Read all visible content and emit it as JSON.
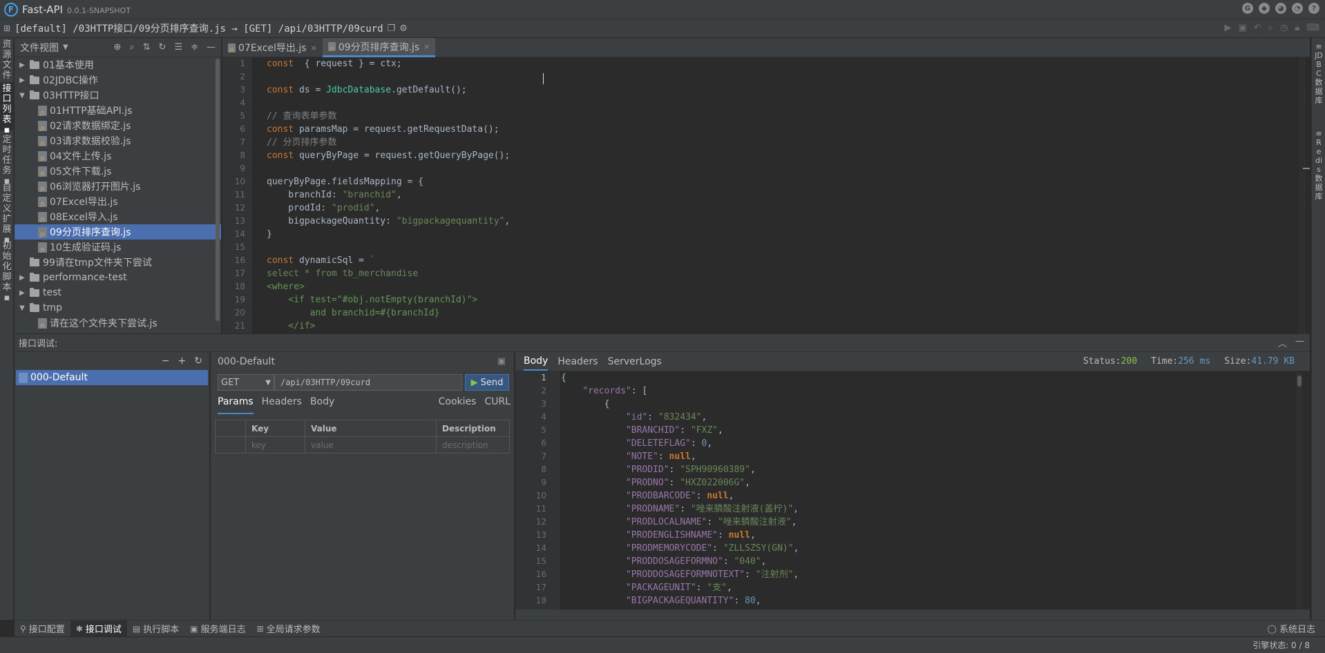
{
  "app": {
    "name": "Fast-API",
    "version": "0.0.1-SNAPSHOT",
    "logo_letter": "F"
  },
  "pathbar": {
    "path": "[default] /03HTTP接口/09分页排序查询.js → [GET] /api/03HTTP/09curd"
  },
  "left_tabs": [
    "资源文件",
    "接口列表",
    "定时任务",
    "自定义扩展",
    "初始化脚本"
  ],
  "right_tabs": [
    "JDBC数据库",
    "Redis数据库"
  ],
  "tree": {
    "title": "文件视图",
    "items": [
      {
        "label": "01基本使用",
        "type": "folder",
        "level": 0,
        "arrow": "▶"
      },
      {
        "label": "02JDBC操作",
        "type": "folder",
        "level": 0,
        "arrow": "▶"
      },
      {
        "label": "03HTTP接口",
        "type": "folder",
        "level": 0,
        "arrow": "▼"
      },
      {
        "label": "01HTTP基础API.js",
        "type": "file",
        "level": 1
      },
      {
        "label": "02请求数据绑定.js",
        "type": "file",
        "level": 1
      },
      {
        "label": "03请求数据校验.js",
        "type": "file",
        "level": 1
      },
      {
        "label": "04文件上传.js",
        "type": "file",
        "level": 1
      },
      {
        "label": "05文件下载.js",
        "type": "file",
        "level": 1
      },
      {
        "label": "06浏览器打开图片.js",
        "type": "file",
        "level": 1
      },
      {
        "label": "07Excel导出.js",
        "type": "file",
        "level": 1
      },
      {
        "label": "08Excel导入.js",
        "type": "file",
        "level": 1
      },
      {
        "label": "09分页排序查询.js",
        "type": "file",
        "level": 1,
        "selected": true
      },
      {
        "label": "10生成验证码.js",
        "type": "file",
        "level": 1
      },
      {
        "label": "99请在tmp文件夹下尝试",
        "type": "folder",
        "level": 0,
        "arrow": ""
      },
      {
        "label": "performance-test",
        "type": "folder",
        "level": 0,
        "arrow": "▶"
      },
      {
        "label": "test",
        "type": "folder",
        "level": 0,
        "arrow": "▶"
      },
      {
        "label": "tmp",
        "type": "folder",
        "level": 0,
        "arrow": "▼"
      },
      {
        "label": "请在这个文件夹下尝试.js",
        "type": "file",
        "level": 1
      }
    ]
  },
  "editor": {
    "tabs": [
      {
        "label": "07Excel导出.js",
        "active": false
      },
      {
        "label": "09分页排序查询.js",
        "active": true
      }
    ],
    "lines": [
      [
        [
          "kw",
          "const"
        ],
        [
          "",
          "  { request } = ctx;"
        ]
      ],
      [],
      [
        [
          "kw",
          "const"
        ],
        [
          "",
          " ds = "
        ],
        [
          "cls",
          "JdbcDatabase"
        ],
        [
          "",
          ".getDefault();"
        ]
      ],
      [],
      [
        [
          "com",
          "// 查询表单参数"
        ]
      ],
      [
        [
          "kw",
          "const"
        ],
        [
          "",
          " paramsMap = request.getRequestData();"
        ]
      ],
      [
        [
          "com",
          "// 分页排序参数"
        ]
      ],
      [
        [
          "kw",
          "const"
        ],
        [
          "",
          " queryByPage = request.getQueryByPage();"
        ]
      ],
      [],
      [
        [
          "",
          "queryByPage.fieldsMapping = {"
        ]
      ],
      [
        [
          "",
          "    branchId: "
        ],
        [
          "str",
          "\"branchid\""
        ],
        [
          "",
          ","
        ]
      ],
      [
        [
          "",
          "    prodId: "
        ],
        [
          "str",
          "\"prodid\""
        ],
        [
          "",
          ","
        ]
      ],
      [
        [
          "",
          "    bigpackageQuantity: "
        ],
        [
          "str",
          "\"bigpackagequantity\""
        ],
        [
          "",
          ","
        ]
      ],
      [
        [
          "",
          "}"
        ]
      ],
      [],
      [
        [
          "kw",
          "const"
        ],
        [
          "",
          " dynamicSql = "
        ],
        [
          "str",
          "`"
        ]
      ],
      [
        [
          "str",
          "select * from tb_merchandise"
        ]
      ],
      [
        [
          "xml",
          "<where>"
        ]
      ],
      [
        [
          "xml",
          "    <if test=\"#obj.notEmpty(branchId)\">"
        ]
      ],
      [
        [
          "xml",
          "        and branchid=#{branchId}"
        ]
      ],
      [
        [
          "xml",
          "    </if>"
        ]
      ]
    ]
  },
  "debug": {
    "title": "接口调试:",
    "list_item": "000-Default",
    "request": {
      "name": "000-Default",
      "method": "GET",
      "url": "/api/03HTTP/09curd",
      "send": "Send",
      "tabs": [
        "Params",
        "Headers",
        "Body"
      ],
      "right_tabs": [
        "Cookies",
        "CURL"
      ],
      "columns": [
        "Key",
        "Value",
        "Description"
      ],
      "placeholders": [
        "key",
        "value",
        "description"
      ]
    },
    "response": {
      "tabs": [
        "Body",
        "Headers",
        "ServerLogs"
      ],
      "status_label": "Status:",
      "status": "200",
      "time_label": "Time:",
      "time": "256 ms",
      "size_label": "Size:",
      "size": "41.79 KB",
      "lines": [
        [
          [
            "",
            "{"
          ]
        ],
        [
          [
            "",
            "    "
          ],
          [
            "jk",
            "\"records\""
          ],
          [
            "",
            ": ["
          ]
        ],
        [
          [
            "",
            "        {"
          ]
        ],
        [
          [
            "",
            "            "
          ],
          [
            "jk",
            "\"id\""
          ],
          [
            "",
            ": "
          ],
          [
            "jsv",
            "\"832434\""
          ],
          [
            "",
            ","
          ]
        ],
        [
          [
            "",
            "            "
          ],
          [
            "jk",
            "\"BRANCHID\""
          ],
          [
            "",
            ": "
          ],
          [
            "jsv",
            "\"FXZ\""
          ],
          [
            "",
            ","
          ]
        ],
        [
          [
            "",
            "            "
          ],
          [
            "jk",
            "\"DELETEFLAG\""
          ],
          [
            "",
            ": "
          ],
          [
            "jn",
            "0"
          ],
          [
            "",
            ","
          ]
        ],
        [
          [
            "",
            "            "
          ],
          [
            "jk",
            "\"NOTE\""
          ],
          [
            "",
            ": "
          ],
          [
            "jnull",
            "null"
          ],
          [
            "",
            ","
          ]
        ],
        [
          [
            "",
            "            "
          ],
          [
            "jk",
            "\"PRODID\""
          ],
          [
            "",
            ": "
          ],
          [
            "jsv",
            "\"SPH90960389\""
          ],
          [
            "",
            ","
          ]
        ],
        [
          [
            "",
            "            "
          ],
          [
            "jk",
            "\"PRODNO\""
          ],
          [
            "",
            ": "
          ],
          [
            "jsv",
            "\"HXZ022006G\""
          ],
          [
            "",
            ","
          ]
        ],
        [
          [
            "",
            "            "
          ],
          [
            "jk",
            "\"PRODBARCODE\""
          ],
          [
            "",
            ": "
          ],
          [
            "jnull",
            "null"
          ],
          [
            "",
            ","
          ]
        ],
        [
          [
            "",
            "            "
          ],
          [
            "jk",
            "\"PRODNAME\""
          ],
          [
            "",
            ": "
          ],
          [
            "jsv",
            "\"唑来膦酸注射液(盖柠)\""
          ],
          [
            "",
            ","
          ]
        ],
        [
          [
            "",
            "            "
          ],
          [
            "jk",
            "\"PRODLOCALNAME\""
          ],
          [
            "",
            ": "
          ],
          [
            "jsv",
            "\"唑来膦酸注射液\""
          ],
          [
            "",
            ","
          ]
        ],
        [
          [
            "",
            "            "
          ],
          [
            "jk",
            "\"PRODENGLISHNAME\""
          ],
          [
            "",
            ": "
          ],
          [
            "jnull",
            "null"
          ],
          [
            "",
            ","
          ]
        ],
        [
          [
            "",
            "            "
          ],
          [
            "jk",
            "\"PRODMEMORYCODE\""
          ],
          [
            "",
            ": "
          ],
          [
            "jsv",
            "\"ZLLSZSY(GN)\""
          ],
          [
            "",
            ","
          ]
        ],
        [
          [
            "",
            "            "
          ],
          [
            "jk",
            "\"PRODDOSAGEFORMNO\""
          ],
          [
            "",
            ": "
          ],
          [
            "jsv",
            "\"040\""
          ],
          [
            "",
            ","
          ]
        ],
        [
          [
            "",
            "            "
          ],
          [
            "jk",
            "\"PRODDOSAGEFORMNOTEXT\""
          ],
          [
            "",
            ": "
          ],
          [
            "jsv",
            "\"注射剂\""
          ],
          [
            "",
            ","
          ]
        ],
        [
          [
            "",
            "            "
          ],
          [
            "jk",
            "\"PACKAGEUNIT\""
          ],
          [
            "",
            ": "
          ],
          [
            "jsv",
            "\"支\""
          ],
          [
            "",
            ","
          ]
        ],
        [
          [
            "",
            "            "
          ],
          [
            "jk",
            "\"BIGPACKAGEQUANTITY\""
          ],
          [
            "",
            ": "
          ],
          [
            "jn",
            "80"
          ],
          [
            "",
            ","
          ]
        ]
      ]
    }
  },
  "bottom_tabs": [
    {
      "label": "接口配置",
      "icon": "⚲",
      "active": false
    },
    {
      "label": "接口调试",
      "icon": "✱",
      "active": true
    },
    {
      "label": "执行脚本",
      "icon": "▤",
      "active": false
    },
    {
      "label": "服务端日志",
      "icon": "▣",
      "active": false
    },
    {
      "label": "全局请求参数",
      "icon": "⊞",
      "active": false
    }
  ],
  "system_log": "系统日志",
  "status_bar": "引擎状态: 0 / 8"
}
